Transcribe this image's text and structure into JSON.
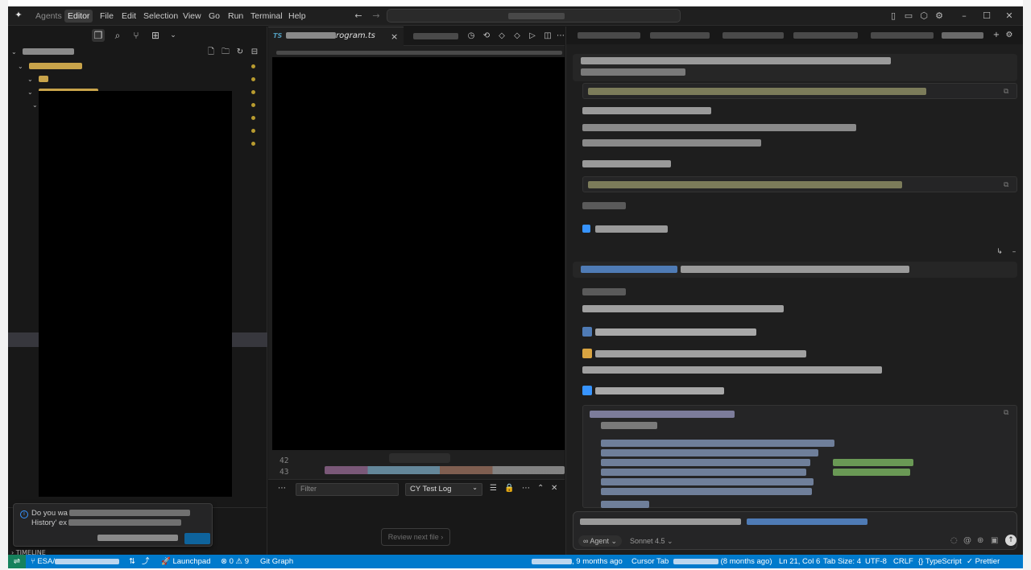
{
  "colors": {
    "accent": "#007acc",
    "window_bg": "#181818",
    "statusbar": "#007acc",
    "folder_yellow": "#e2c08d",
    "modified_dot": "#b89b2f"
  },
  "titlebar": {
    "menu": [
      "Agents",
      "Editor",
      "File",
      "Edit",
      "Selection",
      "View",
      "Go",
      "Run",
      "Terminal",
      "Help"
    ],
    "active_menu": "Editor",
    "icons": [
      "cursor-logo-icon",
      "back-arrow-icon",
      "forward-arrow-icon",
      "layout-sidebar-icon",
      "layout-panel-icon",
      "extensions-icon",
      "settings-gear-icon",
      "minimize-icon",
      "maximize-icon",
      "close-icon"
    ]
  },
  "editor": {
    "tab_prefix": "TS",
    "tab_label_visible": "rogram.ts",
    "close_glyph": "×",
    "line_numbers": [
      "42",
      "43"
    ]
  },
  "panel": {
    "filter_placeholder": "Filter",
    "log_select_value": "CY Test Log",
    "review_button": "Review next file",
    "review_chevron": "›"
  },
  "toast": {
    "line1_start": "Do you wa",
    "line2_start": "History' ex"
  },
  "agent": {
    "input_mode": "Agent",
    "model": "Sonnet 4.5"
  },
  "statusbar": {
    "branch_prefix": "ESA/",
    "launchpad": "Launchpad",
    "problems_errors": "0",
    "problems_warnings": "9",
    "git_graph": "Git Graph",
    "blame_suffix": ", 9 months ago",
    "cursor_tab": "Cursor Tab",
    "blame2_suffix": "(8 months ago)",
    "position": "Ln 21, Col 6",
    "tab_size": "Tab Size: 4",
    "encoding": "UTF-8",
    "eol": "CRLF",
    "language": "TypeScript",
    "formatter": "Prettier"
  },
  "timeline_label": "TIMELINE"
}
